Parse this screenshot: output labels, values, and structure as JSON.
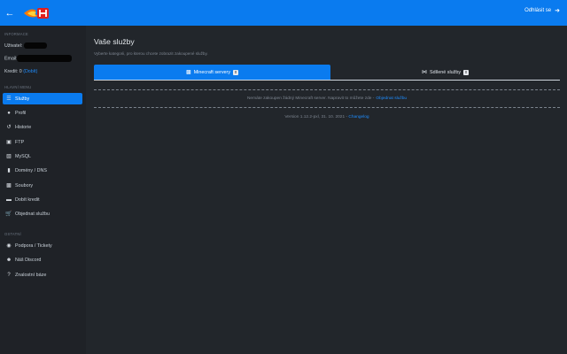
{
  "topbar": {
    "logout_label": "Odhlásit se"
  },
  "sidebar": {
    "info_heading": "INFORMACE",
    "user_label": "Uživatel:",
    "email_label": "Email:",
    "credit_label": "Kredit: 0",
    "credit_link": "(Dobít)",
    "main_menu_heading": "HLAVNÍ MENU",
    "items": [
      {
        "label": "Služby",
        "icon": "list-icon"
      },
      {
        "label": "Profil",
        "icon": "user-icon"
      },
      {
        "label": "Historie",
        "icon": "history-icon"
      },
      {
        "label": "FTP",
        "icon": "ftp-icon"
      },
      {
        "label": "MySQL",
        "icon": "database-icon"
      },
      {
        "label": "Domény / DNS",
        "icon": "bookmark-icon"
      },
      {
        "label": "Soubory",
        "icon": "folder-icon"
      },
      {
        "label": "Dobít kredit",
        "icon": "wallet-icon"
      },
      {
        "label": "Objednat službu",
        "icon": "cart-icon"
      }
    ],
    "other_heading": "OSTATNÍ",
    "other_items": [
      {
        "label": "Podpora / Tickety",
        "icon": "support-icon"
      },
      {
        "label": "Náš Discord",
        "icon": "discord-icon"
      },
      {
        "label": "Znalostní báze",
        "icon": "question-icon"
      }
    ]
  },
  "main": {
    "title": "Vaše služby",
    "subtitle": "Vyberte kategorii, pro kterou chcete zobrazit zakoupené služby.",
    "tabs": [
      {
        "label": "Minecraft servery",
        "count": "0"
      },
      {
        "label": "Sdílené služby",
        "count": "0"
      }
    ],
    "notice_text": "Nemáte zakoupen žádný Minecraft server. Napravit to můžete zde -",
    "notice_link": "Objednat službu",
    "version_text": "Version 1.12.2-pxl, 31. 10. 2021 -",
    "version_link": "Changelog"
  },
  "colors": {
    "accent": "#0a7bef",
    "background": "#22262b",
    "sidebar_bg": "#1f2227",
    "link": "#1e8dff"
  }
}
